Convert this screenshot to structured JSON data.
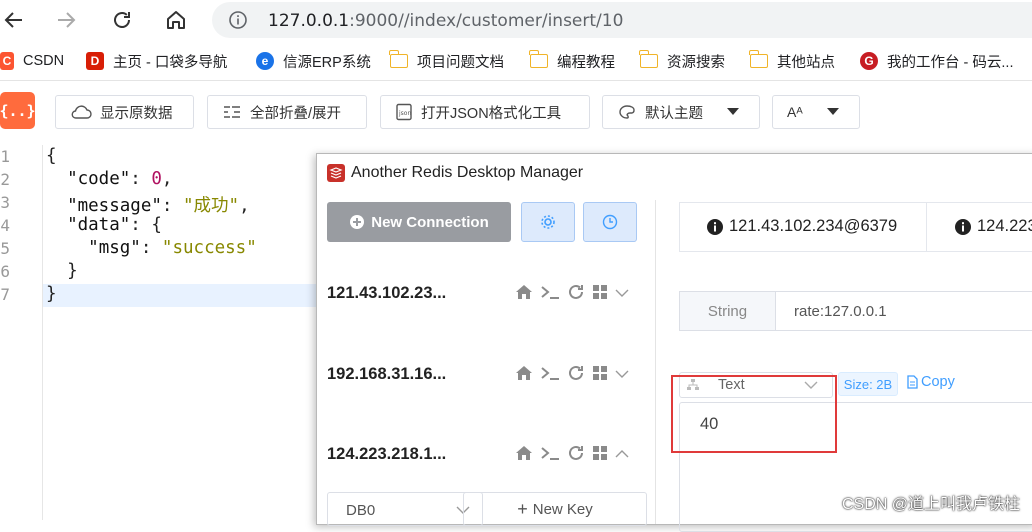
{
  "browser": {
    "url_host": "127.0.0.1",
    "url_rest": ":9000//index/customer/insert/10"
  },
  "bookmarks": [
    {
      "label": "CSDN",
      "icon": "csdn-icon",
      "color": "#fc5531"
    },
    {
      "label": "主页 - 口袋多导航",
      "icon": "d-icon",
      "color": "#d81e06"
    },
    {
      "label": "信源ERP系统",
      "icon": "e-icon",
      "color": "#1a73e8"
    },
    {
      "label": "项目问题文档",
      "icon": "folder-icon"
    },
    {
      "label": "编程教程",
      "icon": "folder-icon"
    },
    {
      "label": "资源搜索",
      "icon": "folder-icon"
    },
    {
      "label": "其他站点",
      "icon": "folder-icon"
    },
    {
      "label": "我的工作台 - 码云...",
      "icon": "gitee-icon",
      "color": "#c71d23"
    }
  ],
  "json_toolbar": {
    "logo": "{..}",
    "raw": "显示原数据",
    "fold": "全部折叠/展开",
    "open_tool": "打开JSON格式化工具",
    "theme": "默认主题",
    "font": "Aᴬ"
  },
  "json_code": {
    "lines": [
      "1",
      "2",
      "3",
      "4",
      "5",
      "6",
      "7"
    ],
    "key_code": "\"code\"",
    "val_code": "0",
    "key_message": "\"message\"",
    "val_message": "\"成功\"",
    "key_data": "\"data\"",
    "key_msg": "\"msg\"",
    "val_msg": "\"success\""
  },
  "redis": {
    "title": "Another Redis Desktop Manager",
    "new_connection": "New Connection",
    "connections": [
      "121.43.102.23...",
      "192.168.31.16...",
      "124.223.218.1..."
    ],
    "db": "DB0",
    "new_key": "New Key",
    "tabs": [
      "121.43.102.234@6379",
      "124.223"
    ],
    "key_type": "String",
    "key_name": "rate:127.0.0.1",
    "view_mode": "Text",
    "size": "Size: 2B",
    "copy": "Copy",
    "value": "40"
  },
  "watermark": "CSDN @道上叫我卢铁柱",
  "colors": {
    "accent": "#409eff",
    "highlight": "#e03a3a",
    "json_logo": "#ff6b3d"
  }
}
